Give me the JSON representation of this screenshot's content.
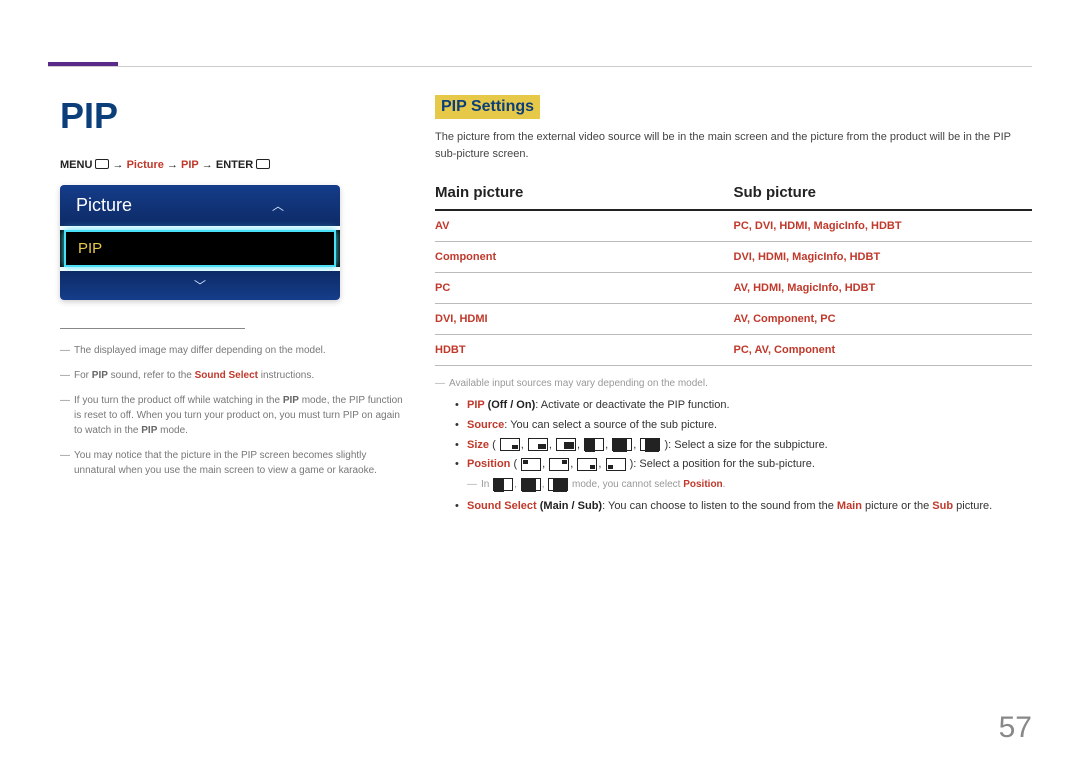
{
  "pageNumber": "57",
  "heading": "PIP",
  "menuPath": {
    "menu": "MENU",
    "arrow": " → ",
    "picture": "Picture",
    "pip": "PIP",
    "enter": "ENTER"
  },
  "osd": {
    "title": "Picture",
    "item": "PIP"
  },
  "leftNotes": [
    "The displayed image may differ depending on the model.",
    "For <b>PIP</b> sound, refer to the <r>Sound Select</r> instructions.",
    "If you turn the product off while watching in the <b>PIP</b> mode, the PIP function is reset to off. When you turn your product on, you must turn PIP on again to watch in the <b>PIP</b> mode.",
    "You may notice that the picture in the PIP screen becomes slightly unnatural when you use the main screen to view a game or karaoke."
  ],
  "section": {
    "title": "PIP Settings",
    "desc": "The picture from the external video source will be in the main screen and the picture from the product will be in the PIP sub-picture screen."
  },
  "table": {
    "headMain": "Main picture",
    "headSub": "Sub picture",
    "rows": [
      {
        "main": "AV",
        "sub": "PC, DVI, HDMI, MagicInfo, HDBT"
      },
      {
        "main": "Component",
        "sub": "DVI, HDMI, MagicInfo, HDBT"
      },
      {
        "main": "PC",
        "sub": "AV, HDMI, MagicInfo, HDBT"
      },
      {
        "main": "DVI, HDMI",
        "sub": "AV, Component, PC"
      },
      {
        "main": "HDBT",
        "sub": "PC, AV, Component"
      }
    ]
  },
  "belowTable": {
    "grayNote": "Available input sources may vary depending on the model.",
    "bullets": {
      "pip_label": "PIP",
      "pip_opts": " (Off / On)",
      "pip_desc": ": Activate or deactivate the PIP function.",
      "source_label": "Source",
      "source_desc": ": You can select a source of the sub picture.",
      "size_label": "Size",
      "size_desc": ": Select a size for the subpicture.",
      "pos_label": "Position",
      "pos_desc": ": Select a position for the sub-picture.",
      "pos_note_pre": "In ",
      "pos_note_mid": " mode, you cannot select ",
      "pos_note_key": "Position",
      "pos_note_end": ".",
      "ss_label": "Sound Select",
      "ss_opts": " (Main / Sub)",
      "ss_desc_a": ": You can choose to listen to the sound from the ",
      "ss_main": "Main",
      "ss_mid": " picture or the ",
      "ss_sub": "Sub",
      "ss_end": " picture."
    }
  }
}
